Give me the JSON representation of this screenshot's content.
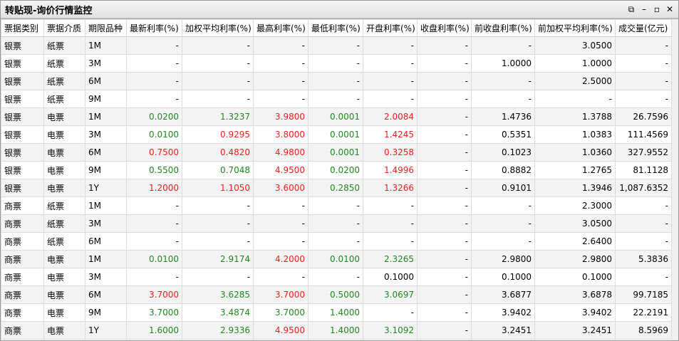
{
  "window": {
    "title": "转贴现-询价行情监控",
    "controls": [
      "restore-external",
      "minimize",
      "maximize",
      "close"
    ]
  },
  "colors": {
    "g": "#1e8a1e",
    "r": "#ff1a1a"
  },
  "columns": [
    "票据类别",
    "票据介质",
    "期限品种",
    "最新利率(%)",
    "加权平均利率(%)",
    "最高利率(%)",
    "最低利率(%)",
    "开盘利率(%)",
    "收盘利率(%)",
    "前收盘利率(%)",
    "前加权平均利率(%)",
    "成交量(亿元)"
  ],
  "rows": [
    {
      "cells": [
        "银票",
        "纸票",
        "1M",
        "-",
        "-",
        "-",
        "-",
        "-",
        "-",
        "-",
        "3.0500",
        "-"
      ],
      "colors": "     "
    },
    {
      "cells": [
        "银票",
        "纸票",
        "3M",
        "-",
        "-",
        "-",
        "-",
        "-",
        "-",
        "1.0000",
        "1.0000",
        "-"
      ],
      "colors": "     "
    },
    {
      "cells": [
        "银票",
        "纸票",
        "6M",
        "-",
        "-",
        "-",
        "-",
        "-",
        "-",
        "-",
        "2.5000",
        "-"
      ],
      "colors": "     "
    },
    {
      "cells": [
        "银票",
        "纸票",
        "9M",
        "-",
        "-",
        "-",
        "-",
        "-",
        "-",
        "-",
        "-",
        "-"
      ],
      "colors": "     "
    },
    {
      "cells": [
        "银票",
        "电票",
        "1M",
        "0.0200",
        "1.3237",
        "3.9800",
        "0.0001",
        "2.0084",
        "-",
        "1.4736",
        "1.3788",
        "26.7596"
      ],
      "colors": "ggrgr"
    },
    {
      "cells": [
        "银票",
        "电票",
        "3M",
        "0.0100",
        "0.9295",
        "3.8000",
        "0.0001",
        "1.4245",
        "-",
        "0.5351",
        "1.0383",
        "111.4569"
      ],
      "colors": "grrgr"
    },
    {
      "cells": [
        "银票",
        "电票",
        "6M",
        "0.7500",
        "0.4820",
        "4.9800",
        "0.0001",
        "0.3258",
        "-",
        "0.1023",
        "1.0360",
        "327.9552"
      ],
      "colors": "rrrgr"
    },
    {
      "cells": [
        "银票",
        "电票",
        "9M",
        "0.5500",
        "0.7048",
        "4.9500",
        "0.0200",
        "1.4996",
        "-",
        "0.8882",
        "1.2765",
        "81.1128"
      ],
      "colors": "ggrgr"
    },
    {
      "cells": [
        "银票",
        "电票",
        "1Y",
        "1.2000",
        "1.1050",
        "3.6000",
        "0.2850",
        "1.3266",
        "-",
        "0.9101",
        "1.3946",
        "1,087.6352"
      ],
      "colors": "rrrgr"
    },
    {
      "cells": [
        "商票",
        "纸票",
        "1M",
        "-",
        "-",
        "-",
        "-",
        "-",
        "-",
        "-",
        "2.3000",
        "-"
      ],
      "colors": "     "
    },
    {
      "cells": [
        "商票",
        "纸票",
        "3M",
        "-",
        "-",
        "-",
        "-",
        "-",
        "-",
        "-",
        "3.0500",
        "-"
      ],
      "colors": "     "
    },
    {
      "cells": [
        "商票",
        "纸票",
        "6M",
        "-",
        "-",
        "-",
        "-",
        "-",
        "-",
        "-",
        "2.6400",
        "-"
      ],
      "colors": "     "
    },
    {
      "cells": [
        "商票",
        "电票",
        "1M",
        "0.0100",
        "2.9174",
        "4.2000",
        "0.0100",
        "2.3265",
        "-",
        "2.9800",
        "2.9800",
        "5.3836"
      ],
      "colors": "ggrgg"
    },
    {
      "cells": [
        "商票",
        "电票",
        "3M",
        "-",
        "-",
        "-",
        "-",
        "0.1000",
        "-",
        "0.1000",
        "0.1000",
        "-"
      ],
      "colors": "     "
    },
    {
      "cells": [
        "商票",
        "电票",
        "6M",
        "3.7000",
        "3.6285",
        "3.7000",
        "0.5000",
        "3.0697",
        "-",
        "3.6877",
        "3.6878",
        "99.7185"
      ],
      "colors": "rgrgg"
    },
    {
      "cells": [
        "商票",
        "电票",
        "9M",
        "3.7000",
        "3.4874",
        "3.7000",
        "1.4000",
        "-",
        "-",
        "3.9402",
        "3.9402",
        "22.2191"
      ],
      "colors": "gggg "
    },
    {
      "cells": [
        "商票",
        "电票",
        "1Y",
        "1.6000",
        "2.9336",
        "4.9500",
        "1.4000",
        "3.1092",
        "-",
        "3.2451",
        "3.2451",
        "8.5969"
      ],
      "colors": "ggrgg"
    }
  ]
}
